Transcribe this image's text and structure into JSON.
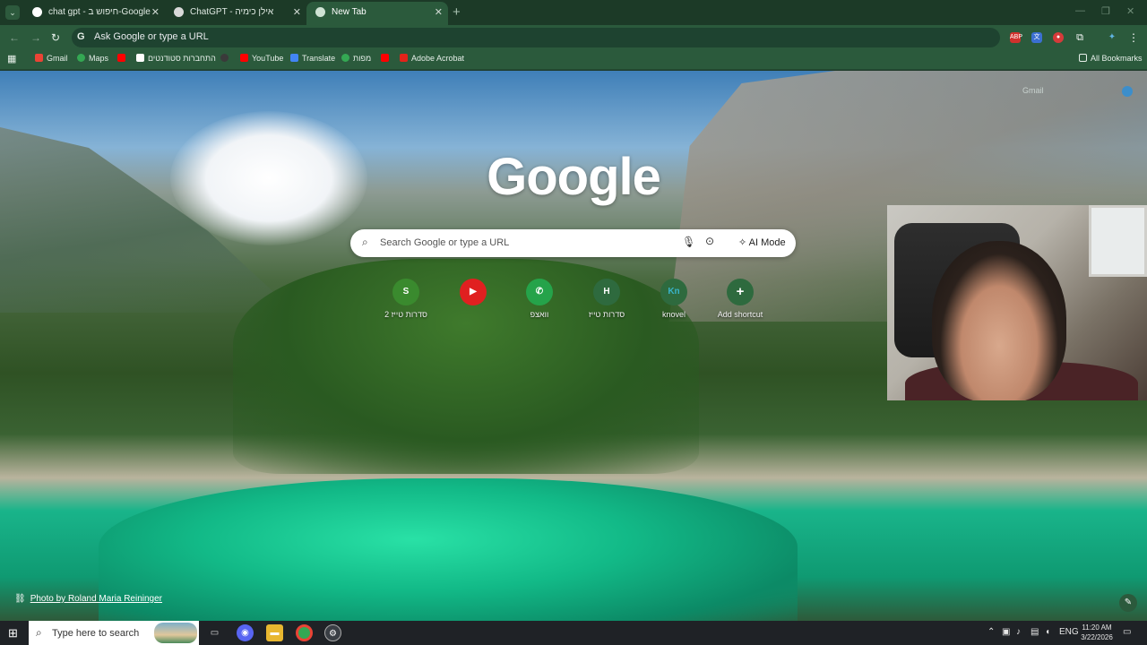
{
  "tabs": [
    {
      "title": "chat gpt - חיפוש ב-Google",
      "fav_color": "#ffffff"
    },
    {
      "title": "ChatGPT - אילן כימיה",
      "fav_color": "#ffffff"
    },
    {
      "title": "New Tab",
      "fav_color": "#ffffff"
    }
  ],
  "tab_close_glyph": "✕",
  "new_tab_glyph": "+",
  "omnibox": {
    "text": "Ask Google or type a URL"
  },
  "bookmarks": {
    "items": [
      {
        "label": "Gmail",
        "icon_color": "#ea4335"
      },
      {
        "label": "Maps",
        "icon_color": "#34a853"
      },
      {
        "label": "",
        "icon_color": "#ff0000"
      },
      {
        "label": "התחברות סטודנטים",
        "icon_color": "#ffffff"
      },
      {
        "label": "",
        "icon_color": "#3a3a3a"
      },
      {
        "label": "YouTube",
        "icon_color": "#ff0000"
      },
      {
        "label": "Translate",
        "icon_color": "#4285f4"
      },
      {
        "label": "מפות",
        "icon_color": "#34a853"
      },
      {
        "label": "",
        "icon_color": "#ff0000"
      },
      {
        "label": "Adobe Acrobat",
        "icon_color": "#e2231a"
      }
    ],
    "all_bookmarks": "All Bookmarks"
  },
  "ntp": {
    "logo": "Google",
    "gmail_link": "Gmail",
    "search_placeholder": "Search Google or type a URL",
    "ai_mode": "AI Mode",
    "shortcuts": [
      {
        "label": "סדרות טייז 2",
        "glyph": "S",
        "color": "#3a8a2e"
      },
      {
        "label": "",
        "glyph": "▶",
        "color": "#e02020"
      },
      {
        "label": "וואצפ",
        "glyph": "✆",
        "color": "#25a34a"
      },
      {
        "label": "סדרות טייז",
        "glyph": "H",
        "color": "#2e6a3e"
      },
      {
        "label": "knovel",
        "glyph": "Kn",
        "color": "#2e6a3e"
      },
      {
        "label": "Add shortcut",
        "glyph": "+",
        "color": "#2e6a3e"
      }
    ],
    "photo_credit": "Photo by Roland Maria Reininger"
  },
  "taskbar": {
    "search_text": "Type here to search",
    "language": "ENG",
    "time": "11:20 AM",
    "date": "3/22/2026"
  },
  "colors": {
    "accent": "#2b5a3c",
    "tabstrip": "#1c3a27"
  }
}
